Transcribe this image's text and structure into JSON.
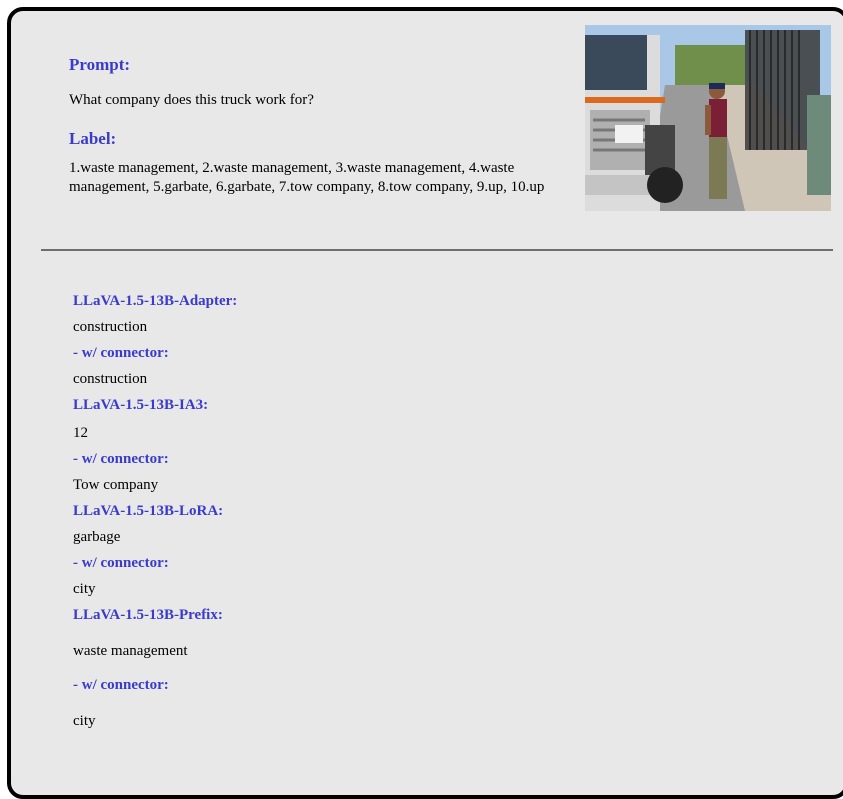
{
  "prompt": {
    "heading": "Prompt:",
    "text": "What company does this truck work for?"
  },
  "label": {
    "heading": "Label:",
    "text": "1.waste management, 2.waste management, 3.waste management, 4.waste management, 5.garbate, 6.garbate, 7.tow company, 8.tow company, 9.up, 10.up"
  },
  "models": [
    {
      "name": "LLaVA-1.5-13B-Adapter:",
      "answer": "construction",
      "connector_label": "- w/ connector:",
      "connector_answer": "construction"
    },
    {
      "name": "LLaVA-1.5-13B-IA3:",
      "answer": "12",
      "connector_label": "- w/ connector:",
      "connector_answer": "Tow company"
    },
    {
      "name": "LLaVA-1.5-13B-LoRA:",
      "answer": "garbage",
      "connector_label": "- w/ connector:",
      "connector_answer": "city"
    },
    {
      "name": "LLaVA-1.5-13B-Prefix:",
      "answer": "waste management",
      "connector_label": "- w/ connector:",
      "connector_answer": "city"
    }
  ],
  "colors": {
    "accent": "#3a3acb",
    "card_bg": "#e8e8e8",
    "divider": "#6e6e6e"
  },
  "icons": {
    "photo": "truck-street-photo"
  }
}
